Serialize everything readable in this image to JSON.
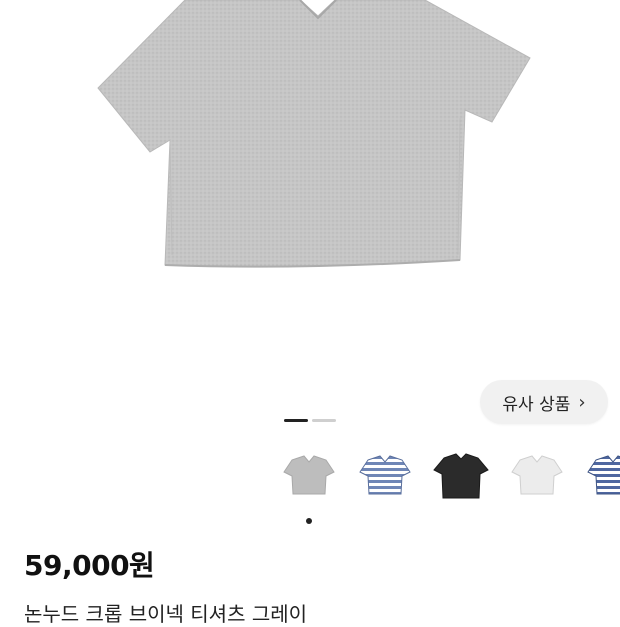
{
  "product": {
    "price": "59,000원",
    "title": "논누드 크롭 브이넥 티셔츠 그레이"
  },
  "similar_button": {
    "label": "유사 상품",
    "icon": "chevron-right-icon",
    "chevron": "›"
  },
  "gallery": {
    "page_count": 2,
    "active_page": 1
  },
  "thumbnails": [
    {
      "name": "thumb-gray-tee",
      "color": "#bdbdbd"
    },
    {
      "name": "thumb-blue-stripe-tee",
      "color": "#6f86b6"
    },
    {
      "name": "thumb-black-tee",
      "color": "#2b2b2b"
    },
    {
      "name": "thumb-white-tee",
      "color": "#ececec"
    },
    {
      "name": "thumb-navy-stripe-tee",
      "color": "#4f67a0"
    }
  ],
  "colors": {
    "shirt_main": "#c4c4c4"
  }
}
